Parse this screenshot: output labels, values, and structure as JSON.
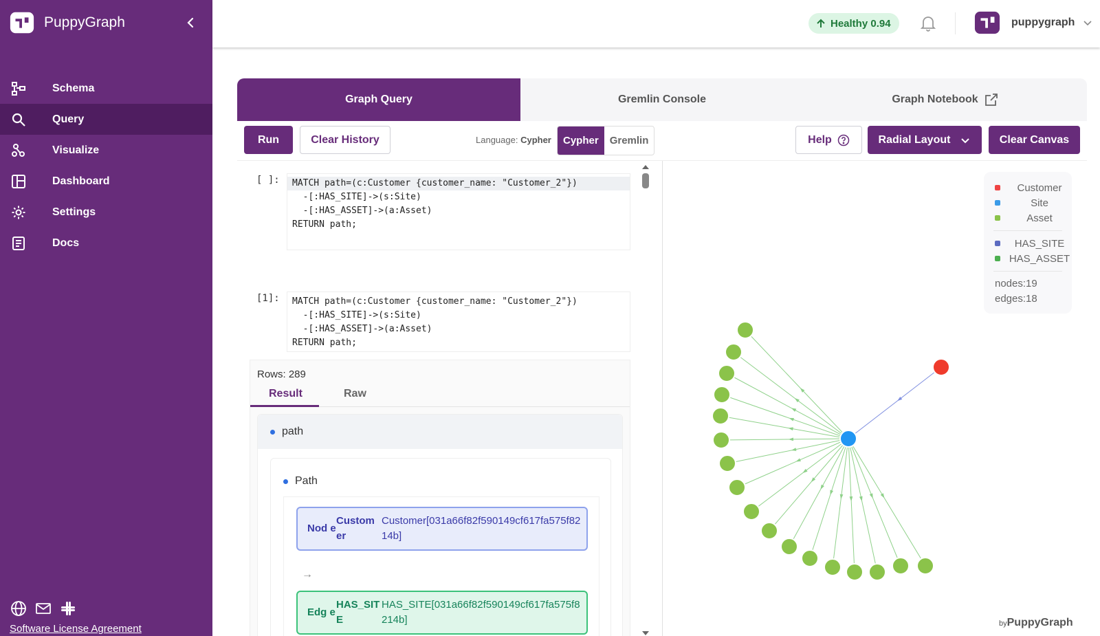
{
  "app": {
    "brand_name": "PuppyGraph"
  },
  "sidebar": {
    "items": [
      {
        "label": "Schema",
        "icon": "schema-icon"
      },
      {
        "label": "Query",
        "icon": "search-icon"
      },
      {
        "label": "Visualize",
        "icon": "visualize-icon"
      },
      {
        "label": "Dashboard",
        "icon": "dashboard-icon"
      },
      {
        "label": "Settings",
        "icon": "gear-icon"
      },
      {
        "label": "Docs",
        "icon": "docs-icon"
      }
    ],
    "active": "Query",
    "license_link": "Software License Agreement"
  },
  "topbar": {
    "health_text": "Healthy 0.94",
    "username": "puppygraph"
  },
  "tabs": [
    {
      "label": "Graph Query"
    },
    {
      "label": "Gremlin Console"
    },
    {
      "label": "Graph Notebook"
    }
  ],
  "toolbar": {
    "run": "Run",
    "clear_history": "Clear History",
    "language_prefix": "Language:",
    "language_value": "Cypher",
    "lang_opt_cypher": "Cypher",
    "lang_opt_gremlin": "Gremlin",
    "help": "Help",
    "layout": "Radial Layout",
    "clear_canvas": "Clear Canvas"
  },
  "cells": [
    {
      "prompt": "[ ]:",
      "code": [
        "MATCH path=(c:Customer {customer_name: \"Customer_2\"})",
        "  -[:HAS_SITE]->(s:Site)",
        "  -[:HAS_ASSET]->(a:Asset)",
        "RETURN path;"
      ]
    },
    {
      "prompt": "[1]:",
      "code": [
        "MATCH path=(c:Customer {customer_name: \"Customer_2\"})",
        "  -[:HAS_SITE]->(s:Site)",
        "  -[:HAS_ASSET]->(a:Asset)",
        "RETURN path;"
      ]
    }
  ],
  "result": {
    "rows": "Rows: 289",
    "tab_result": "Result",
    "tab_raw": "Raw",
    "path_header": "path",
    "inner_header": "Path",
    "node_chip": {
      "kind": "Nod e",
      "label": "Custom er",
      "value": "Customer[031a66f82f590149cf617fa575f8214b]"
    },
    "edge_chip": {
      "kind": "Edg e",
      "label": "HAS_SIT E",
      "value": "HAS_SITE[031a66f82f590149cf617fa575f8214b]"
    },
    "arrow": "→"
  },
  "legend": {
    "nodes": [
      {
        "label": "Customer",
        "color": "#ef4444"
      },
      {
        "label": "Site",
        "color": "#3b9be8"
      },
      {
        "label": "Asset",
        "color": "#8bc34a"
      }
    ],
    "edges": [
      {
        "label": "HAS_SITE",
        "color": "#5c6bc0"
      },
      {
        "label": "HAS_ASSET",
        "color": "#4caf50"
      }
    ],
    "nodes_count": "nodes:19",
    "edges_count": "edges:18"
  },
  "graph": {
    "customer_color": "#ef3b2c",
    "site_color": "#2196f3",
    "asset_color": "#8bc34a",
    "asset_count": 17
  },
  "byline": {
    "prefix": "by",
    "name": "PuppyGraph"
  }
}
